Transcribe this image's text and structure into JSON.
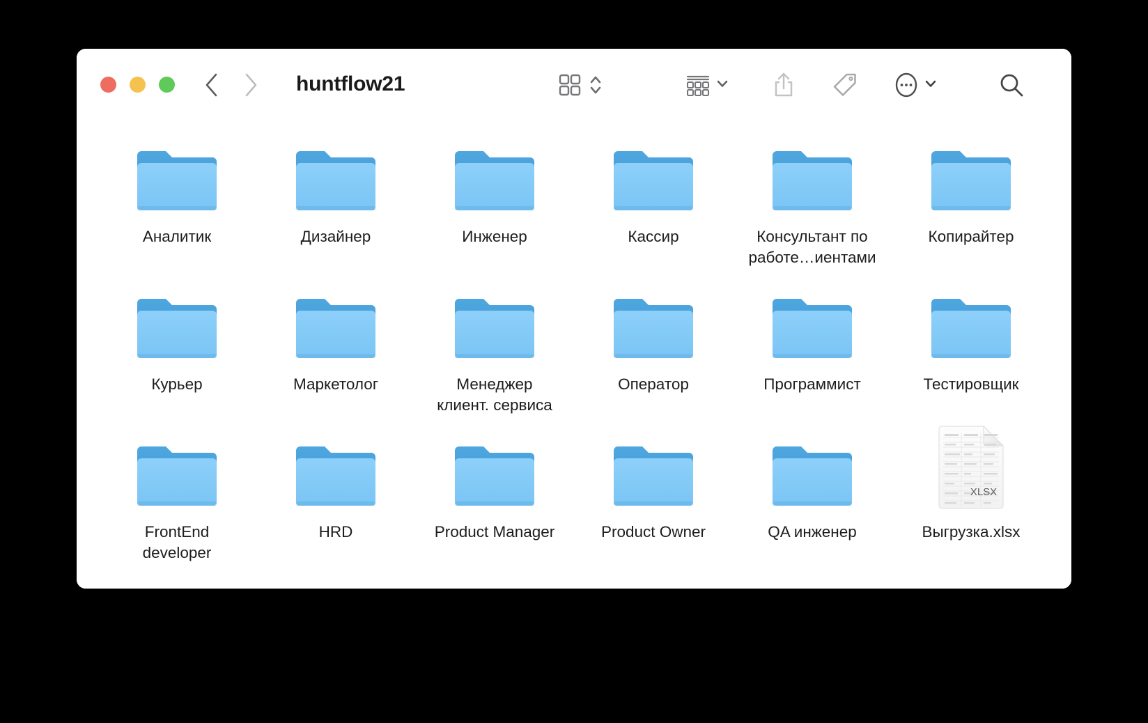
{
  "window": {
    "title": "huntflow21",
    "traffic_lights": [
      {
        "name": "close",
        "color": "#ef6c60",
        "label": "Close"
      },
      {
        "name": "minimize",
        "color": "#f5c14f",
        "label": "Minimize"
      },
      {
        "name": "maximize",
        "color": "#5fc95a",
        "label": "Maximize"
      }
    ],
    "nav": {
      "back_icon": "chevron-left-icon",
      "forward_icon": "chevron-right-icon"
    },
    "toolbar": [
      {
        "name": "icon-view-button",
        "icon": "grid-view-icon",
        "has_stepper": true,
        "stepper_icon": "chevron-up-down-icon"
      },
      {
        "name": "group-by-button",
        "icon": "group-list-icon",
        "has_caret": true
      },
      {
        "name": "share-button",
        "icon": "share-upload-icon",
        "has_caret": false,
        "disabled": true
      },
      {
        "name": "tags-button",
        "icon": "tag-icon",
        "has_caret": false
      },
      {
        "name": "more-actions-button",
        "icon": "ellipsis-circle-icon",
        "has_caret": true
      },
      {
        "name": "search-button",
        "icon": "search-icon",
        "has_caret": false
      }
    ]
  },
  "files": [
    {
      "name": "Аналитик",
      "type": "folder"
    },
    {
      "name": "Дизайнер",
      "type": "folder"
    },
    {
      "name": "Инженер",
      "type": "folder"
    },
    {
      "name": "Кассир",
      "type": "folder"
    },
    {
      "name": "Консультант по\nработе…иентами",
      "type": "folder"
    },
    {
      "name": "Копирайтер",
      "type": "folder"
    },
    {
      "name": "Курьер",
      "type": "folder"
    },
    {
      "name": "Маркетолог",
      "type": "folder"
    },
    {
      "name": "Менеджер\nклиент. сервиса",
      "type": "folder"
    },
    {
      "name": "Оператор",
      "type": "folder"
    },
    {
      "name": "Программист",
      "type": "folder"
    },
    {
      "name": "Тестировщик",
      "type": "folder"
    },
    {
      "name": "FrontEnd\ndeveloper",
      "type": "folder"
    },
    {
      "name": "HRD",
      "type": "folder"
    },
    {
      "name": "Product Manager",
      "type": "folder"
    },
    {
      "name": "Product Owner",
      "type": "folder"
    },
    {
      "name": "QA инженер",
      "type": "folder"
    },
    {
      "name": "Выгрузка.xlsx",
      "type": "xlsx",
      "badge": "XLSX"
    }
  ],
  "colors": {
    "folder_front": "#7ec8f7",
    "folder_back": "#4aa3dd",
    "window_bg": "#ffffff",
    "desktop_bg": "#000000",
    "text": "#1d1d1f",
    "toolbar_icon": "#76767a",
    "toolbar_icon_disabled": "#c3c3c6"
  }
}
